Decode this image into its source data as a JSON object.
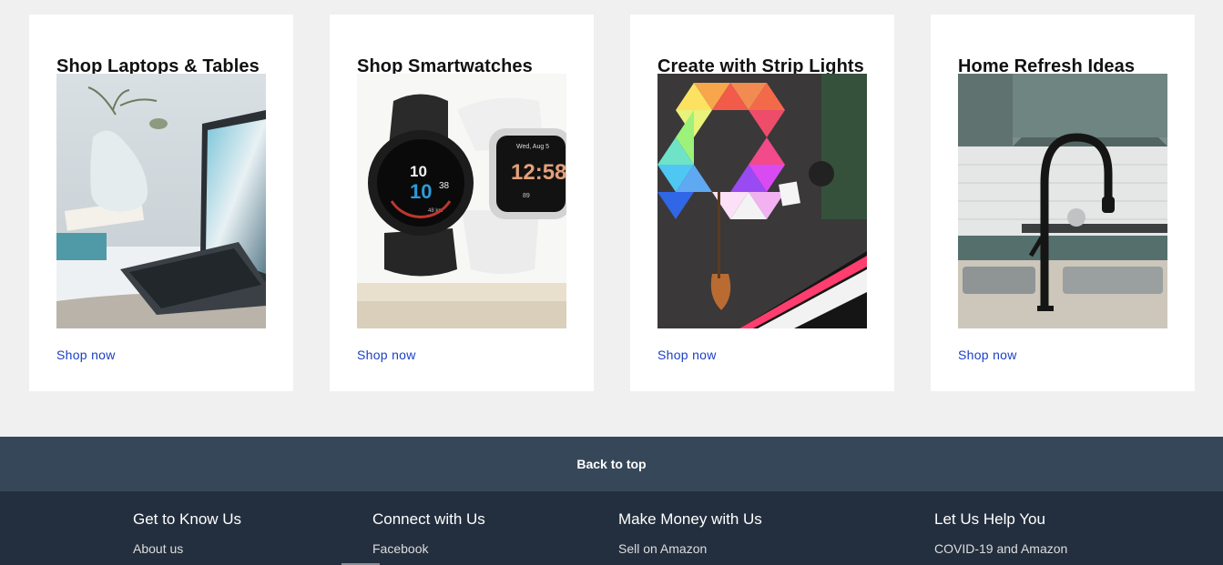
{
  "cards": [
    {
      "title": "Shop Laptops & Tables",
      "link": "Shop now",
      "image": "laptop-with-vase-photo"
    },
    {
      "title": "Shop Smartwatches",
      "link": "Shop now",
      "image": "smartwatches-photo"
    },
    {
      "title": "Create with Strip Lights",
      "link": "Shop now",
      "image": "led-light-panels-photo"
    },
    {
      "title": "Home Refresh Ideas",
      "link": "Shop now",
      "image": "kitchen-faucet-photo"
    }
  ],
  "watch": {
    "black_face": {
      "top": "10",
      "main": "10",
      "sub": "38",
      "label": "48 km"
    },
    "white_face": {
      "date": "Wed, Aug 5",
      "time": "12:58",
      "stat": "89"
    }
  },
  "back_to_top": "Back to top",
  "footer": {
    "columns": [
      {
        "heading": "Get to Know Us",
        "link": "About us"
      },
      {
        "heading": "Connect with Us",
        "link": "Facebook"
      },
      {
        "heading": "Make Money with Us",
        "link": "Sell on Amazon"
      },
      {
        "heading": "Let Us Help You",
        "link": "COVID-19 and Amazon"
      }
    ]
  },
  "colors": {
    "page_bg": "#f0f0f0",
    "card_bg": "#ffffff",
    "link": "#1a3fc4",
    "back_to_top_bg": "#37475a",
    "footer_bg": "#232f3e"
  }
}
